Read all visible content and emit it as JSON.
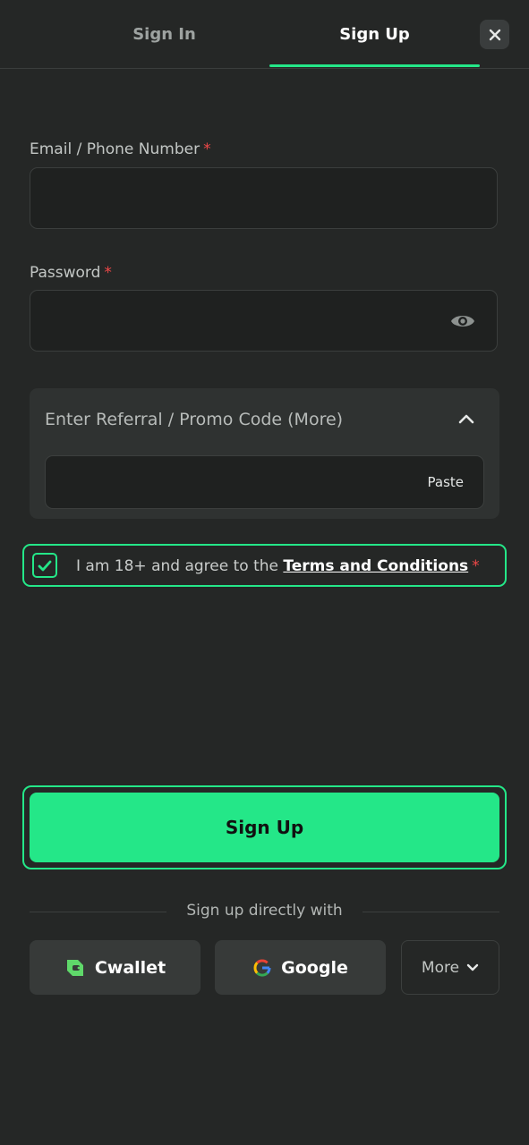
{
  "tabs": {
    "signin": "Sign In",
    "signup": "Sign Up",
    "active": "signup"
  },
  "close_icon": "close-icon",
  "form": {
    "email": {
      "label": "Email / Phone Number",
      "required": "*",
      "value": ""
    },
    "password": {
      "label": "Password",
      "required": "*",
      "value": "",
      "icon": "eye-icon"
    },
    "promo": {
      "title": "Enter Referral / Promo Code (More)",
      "value": "",
      "paste_label": "Paste",
      "expanded": true
    },
    "agree": {
      "text": "I am 18+ and agree to the ",
      "link": "Terms and Conditions",
      "required": "*",
      "checked": true
    }
  },
  "signup_button": "Sign Up",
  "social": {
    "divider": "Sign up directly with",
    "cwallet": "Cwallet",
    "google": "Google",
    "more": "More"
  },
  "colors": {
    "accent": "#24e788",
    "background": "#252726",
    "required": "#f04848"
  }
}
